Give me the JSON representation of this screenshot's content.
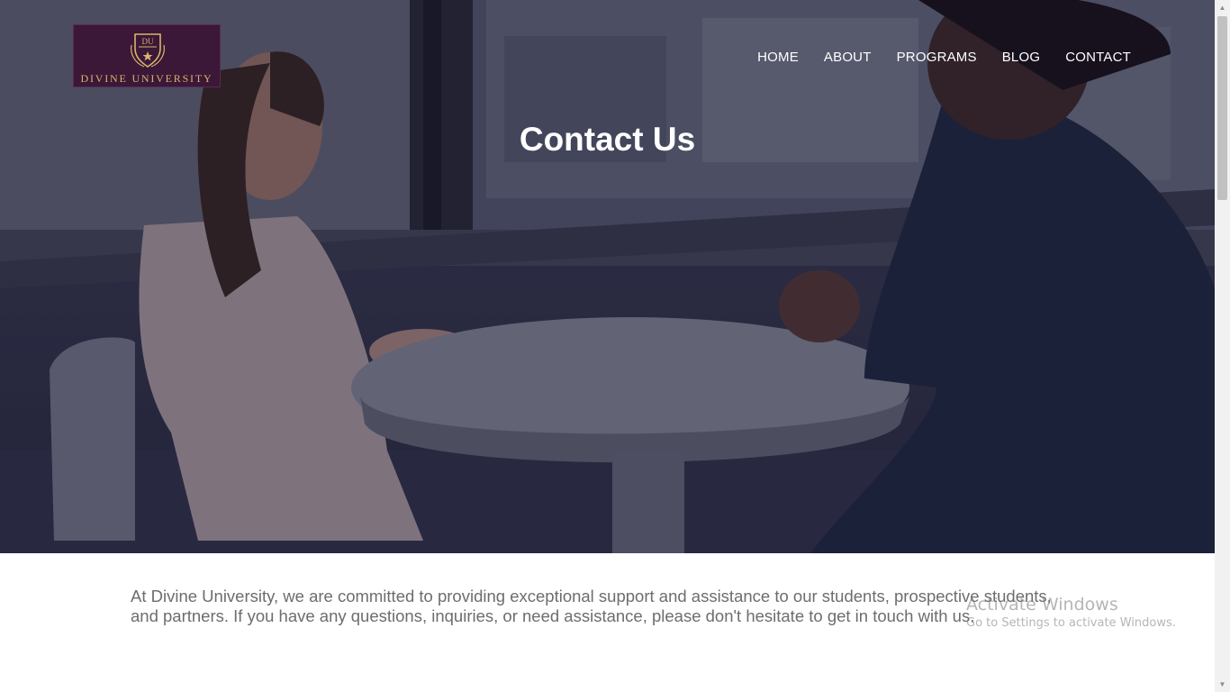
{
  "brand": {
    "name": "DIVINE UNIVERSITY",
    "monogram": "DU"
  },
  "nav": {
    "items": [
      {
        "label": "HOME"
      },
      {
        "label": "ABOUT"
      },
      {
        "label": "PROGRAMS"
      },
      {
        "label": "BLOG"
      },
      {
        "label": "CONTACT"
      }
    ]
  },
  "hero": {
    "title": "Contact Us"
  },
  "intro": {
    "text": "At Divine University, we are committed to providing exceptional support and assistance to our students, prospective students, and partners. If you have any questions, inquiries, or need assistance, please don't hesitate to get in touch with us."
  },
  "watermark": {
    "title": "Activate Windows",
    "subtitle": "Go to Settings to activate Windows."
  },
  "colors": {
    "logo_bg": "#3b1738",
    "logo_gold": "#d8b56a",
    "overlay": "#14122d",
    "intro_text": "#6d6d6d"
  }
}
